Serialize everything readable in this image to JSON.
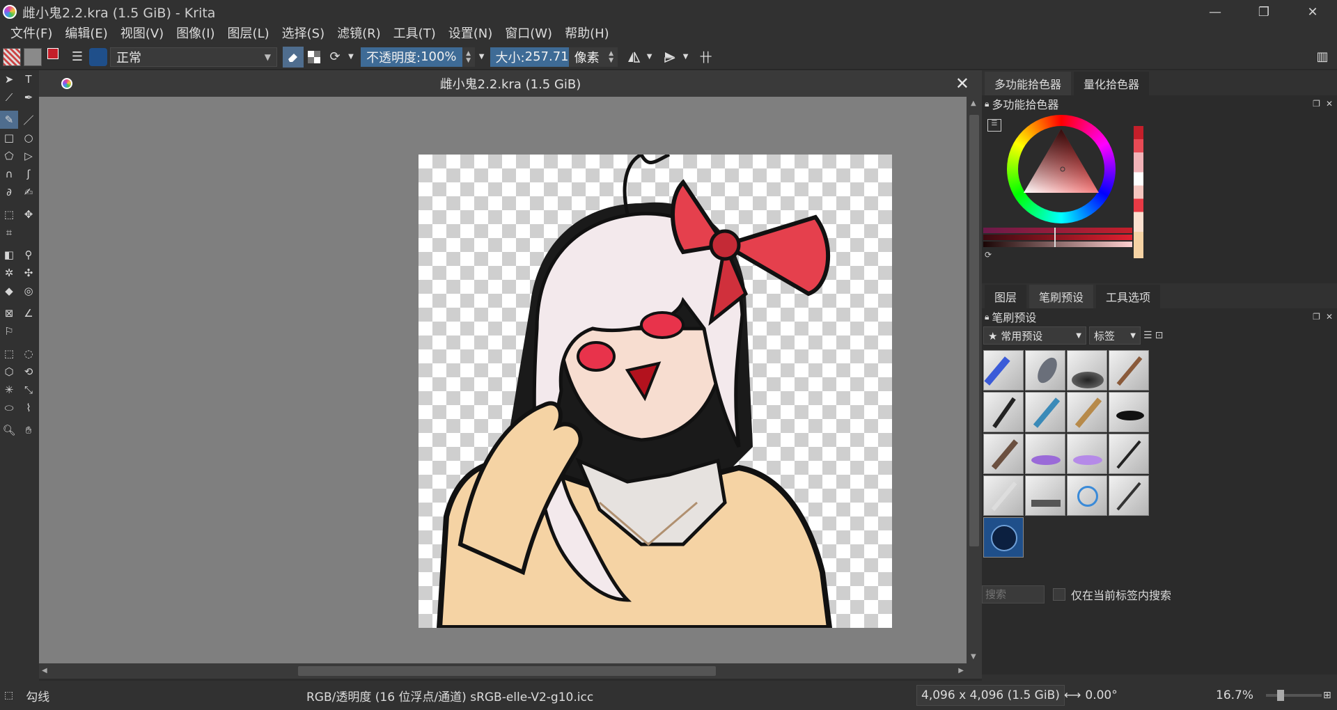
{
  "window": {
    "title": "雌小鬼2.2.kra (1.5 GiB)  - Krita",
    "minimize": "—",
    "restore": "❐",
    "close": "✕"
  },
  "menu": [
    "文件(F)",
    "编辑(E)",
    "视图(V)",
    "图像(I)",
    "图层(L)",
    "选择(S)",
    "滤镜(R)",
    "工具(T)",
    "设置(N)",
    "窗口(W)",
    "帮助(H)"
  ],
  "toolbar": {
    "blend_mode": "正常",
    "opacity_label": "不透明度: ",
    "opacity_value": "100%",
    "size_label": "大小: ",
    "size_value": "257.71",
    "size_unit": "像素",
    "opacity_fill": 1.0,
    "size_fill": 0.55
  },
  "document": {
    "tab_title": "雌小鬼2.2.kra (1.5 GiB)",
    "close": "✕"
  },
  "dock": {
    "top_tabs": [
      "多功能拾色器",
      "量化拾色器"
    ],
    "color_panel_title": "多功能拾色器",
    "mid_tabs": [
      "图层",
      "笔刷预设",
      "工具选项"
    ],
    "brush_panel_title": "笔刷预设",
    "preset_filter": "★ 常用预设",
    "tag_label": "标签",
    "search_placeholder": "搜索",
    "filter_checkbox_label": "仅在当前标签内搜索"
  },
  "status": {
    "tool_name": "勾线",
    "color_space": "RGB/透明度 (16 位浮点/通道)  sRGB-elle-V2-g10.icc",
    "image_size": "4,096 x 4,096 (1.5 GiB)",
    "rotation": "0.00°",
    "zoom": "16.7%"
  },
  "colors": {
    "accent": "#4f6d8e",
    "fg_color": "#c41f2a",
    "bg_color": "#000000"
  }
}
